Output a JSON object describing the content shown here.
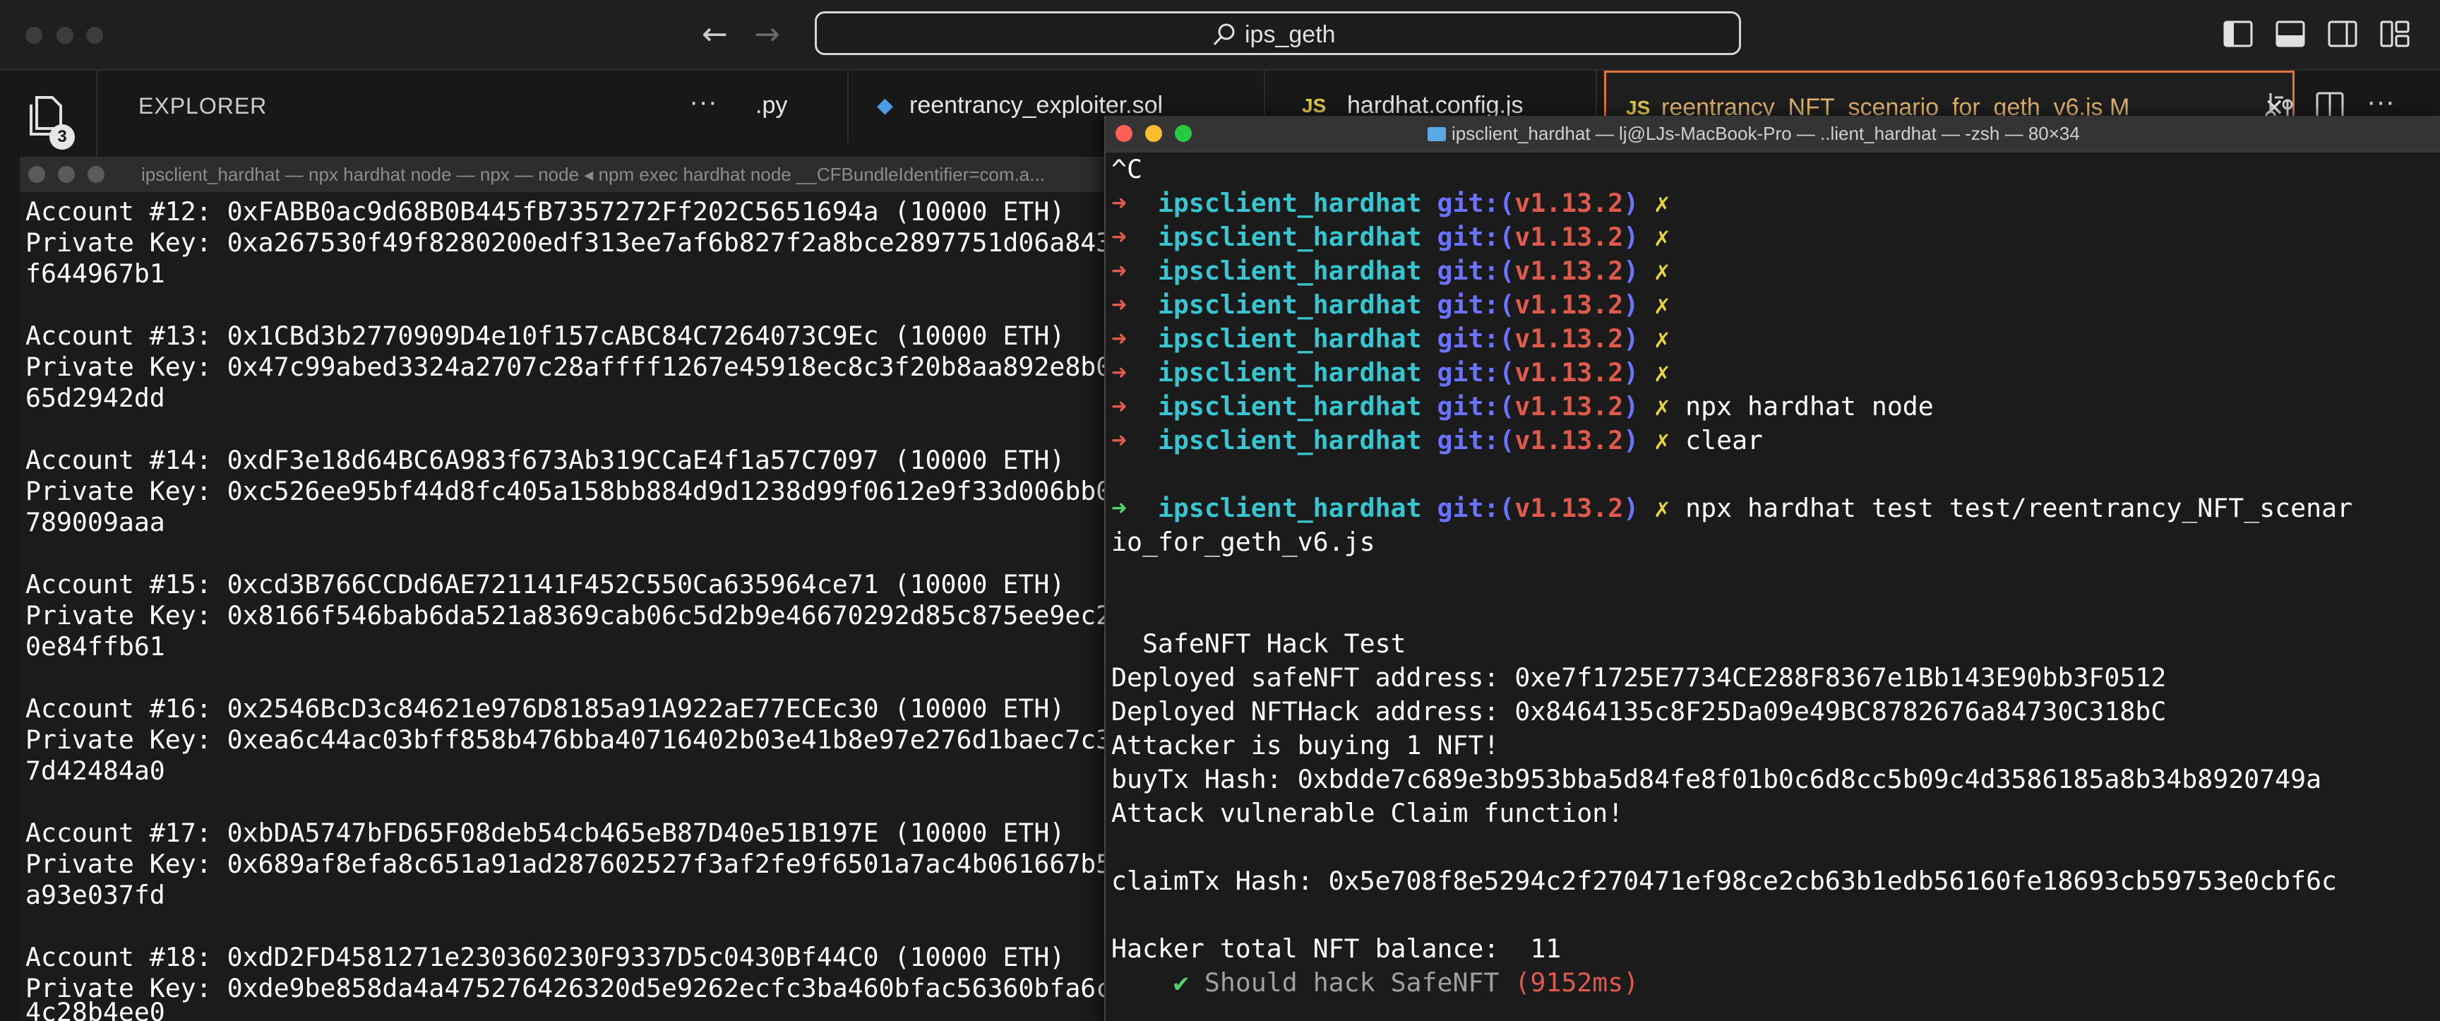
{
  "titlebar": {
    "search_text": "ips_geth",
    "back": "←",
    "forward": "→"
  },
  "explorer": {
    "title": "EXPLORER",
    "more": "···",
    "badge_count": "3"
  },
  "tabs": [
    {
      "label": ".py",
      "icon": ""
    },
    {
      "label": "reentrancy_exploiter.sol",
      "icon": "◆"
    },
    {
      "label": "hardhat.config.js",
      "icon": "JS"
    },
    {
      "label": "reentrancy_NFT_scenario_for_geth_v6.js M",
      "icon": "JS",
      "close": "✕"
    }
  ],
  "left_terminal": {
    "title": "ipsclient_hardhat — npx hardhat node — npx — node ◂ npm exec hardhat node __CFBundleIdentifier=com.a...",
    "lines": [
      "Account #12: 0xFABB0ac9d68B0B445fB7357272Ff202C5651694a (10000 ETH)",
      "Private Key: 0xa267530f49f8280200edf313ee7af6b827f2a8bce2897751d06a843",
      "f644967b1",
      "",
      "Account #13: 0x1CBd3b2770909D4e10f157cABC84C7264073C9Ec (10000 ETH)",
      "Private Key: 0x47c99abed3324a2707c28affff1267e45918ec8c3f20b8aa892e8b0",
      "65d2942dd",
      "",
      "Account #14: 0xdF3e18d64BC6A983f673Ab319CCaE4f1a57C7097 (10000 ETH)",
      "Private Key: 0xc526ee95bf44d8fc405a158bb884d9d1238d99f0612e9f33d006bb0",
      "789009aaa",
      "",
      "Account #15: 0xcd3B766CCDd6AE721141F452C550Ca635964ce71 (10000 ETH)",
      "Private Key: 0x8166f546bab6da521a8369cab06c5d2b9e46670292d85c875ee9ec2",
      "0e84ffb61",
      "",
      "Account #16: 0x2546BcD3c84621e976D8185a91A922aE77ECEc30 (10000 ETH)",
      "Private Key: 0xea6c44ac03bff858b476bba40716402b03e41b8e97e276d1baec7c3",
      "7d42484a0",
      "",
      "Account #17: 0xbDA5747bFD65F08deb54cb465eB87D40e51B197E (10000 ETH)",
      "Private Key: 0x689af8efa8c651a91ad287602527f3af2fe9f6501a7ac4b061667b5",
      "a93e037fd",
      "",
      "Account #18: 0xdD2FD4581271e230360230F9337D5c0430Bf44C0 (10000 ETH)",
      "Private Key: 0xde9be858da4a475276426320d5e9262ecfc3ba460bfac56360bfa6c",
      "4c28b4ee0"
    ]
  },
  "right_terminal": {
    "title": "ipsclient_hardhat — lj@LJs-MacBook-Pro — ..lient_hardhat — -zsh — 80×34",
    "prompt": {
      "arrow": "➜",
      "dir": "ipsclient_hardhat",
      "git": "git:(",
      "branch": "v1.13.2",
      "git_close": ")",
      "dirty": "✗"
    },
    "ctrl_c": "^C",
    "commands": [
      "",
      "",
      "",
      "",
      "",
      "",
      "npx hardhat node",
      "clear"
    ],
    "test_command": "npx hardhat test test/reentrancy_NFT_scenar",
    "test_command_wrap": "io_for_geth_v6.js",
    "output": [
      "  SafeNFT Hack Test",
      "Deployed safeNFT address: 0xe7f1725E7734CE288F8367e1Bb143E90bb3F0512",
      "Deployed NFTHack address: 0x8464135c8F25Da09e49BC8782676a84730C318bC",
      "Attacker is buying 1 NFT!",
      "buyTx Hash: 0xbdde7c689e3b953bba5d84fe8f01b0c6d8cc5b09c4d3586185a8b34b8920749a",
      "Attack vulnerable Claim function!",
      "",
      "claimTx Hash: 0x5e708f8e5294c2f270471ef98ce2cb63b1edb56160fe18693cb59753e0cbf6c",
      "",
      "Hacker total NFT balance:  11"
    ],
    "result": {
      "check": "✔",
      "text": "Should hack SafeNFT",
      "time": "(9152ms)"
    }
  }
}
